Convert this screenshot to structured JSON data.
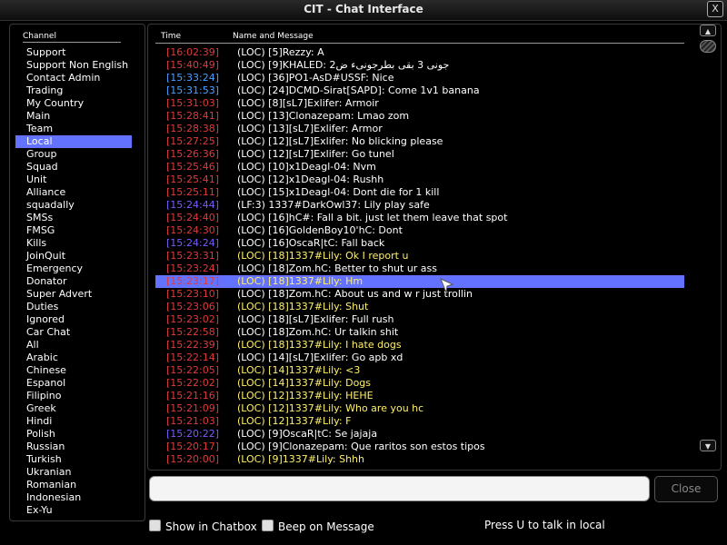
{
  "window": {
    "title": "CIT - Chat Interface",
    "close_glyph": "X"
  },
  "channels": {
    "header": "Channel",
    "selected_index": 7,
    "items": [
      "Support",
      "Support Non English",
      "Contact Admin",
      "Trading",
      "My Country",
      "Main",
      "Team",
      "Local",
      "Group",
      "Squad",
      "Unit",
      "Alliance",
      "squadally",
      "SMSs",
      "FMSG",
      "Kills",
      "JoinQuit",
      "Emergency",
      "Donator",
      "Super Advert",
      "Duties",
      "Ignored",
      "Car Chat",
      "All",
      "Arabic",
      "Chinese",
      "Espanol",
      "Filipino",
      "Greek",
      "Hindi",
      "Polish",
      "Russian",
      "Turkish",
      "Ukranian",
      "Romanian",
      "Indonesian",
      "Ex-Yu"
    ]
  },
  "messages": {
    "col_time": "Time",
    "col_name": "Name and Message",
    "selected_index": 18,
    "items": [
      {
        "time": "[16:02:39]",
        "text": "(LOC) [5]Rezzy: A",
        "time_color": "#e03a3a",
        "text_color": "#ffffff"
      },
      {
        "time": "[15:40:49]",
        "text": "(LOC) [9]KHALED: جونى 3 بقى بطرجونىء ض2",
        "time_color": "#e03a3a",
        "text_color": "#ffffff"
      },
      {
        "time": "[15:33:24]",
        "text": "(LOC) [36]PO1-AsD#USSF: Nice",
        "time_color": "#4aa0ff",
        "text_color": "#ffffff"
      },
      {
        "time": "[15:31:53]",
        "text": "(LOC) [24]DCMD-Sirat[SAPD]: Come 1v1 banana",
        "time_color": "#4aa0ff",
        "text_color": "#ffffff"
      },
      {
        "time": "[15:31:03]",
        "text": "(LOC) [8][sL7]Exlifer: Armoir",
        "time_color": "#e03a3a",
        "text_color": "#ffffff"
      },
      {
        "time": "[15:28:41]",
        "text": "(LOC) [13]Clonazepam: Lmao zom",
        "time_color": "#e03a3a",
        "text_color": "#ffffff"
      },
      {
        "time": "[15:28:38]",
        "text": "(LOC) [13][sL7]Exlifer: Armor",
        "time_color": "#e03a3a",
        "text_color": "#ffffff"
      },
      {
        "time": "[15:27:25]",
        "text": "(LOC) [12][sL7]Exlifer: No blicking please",
        "time_color": "#e03a3a",
        "text_color": "#ffffff"
      },
      {
        "time": "[15:26:36]",
        "text": "(LOC) [12][sL7]Exlifer: Go tunel",
        "time_color": "#e03a3a",
        "text_color": "#ffffff"
      },
      {
        "time": "[15:25:46]",
        "text": "(LOC) [10]x1Deagl-04: Nvm",
        "time_color": "#e03a3a",
        "text_color": "#ffffff"
      },
      {
        "time": "[15:25:41]",
        "text": "(LOC) [12]x1Deagl-04: Rushh",
        "time_color": "#e03a3a",
        "text_color": "#ffffff"
      },
      {
        "time": "[15:25:11]",
        "text": "(LOC) [15]x1Deagl-04: Dont die for 1 kill",
        "time_color": "#e03a3a",
        "text_color": "#ffffff"
      },
      {
        "time": "[15:24:44]",
        "text": "(LF:3) 1337#DarkOwl37: Lily play safe",
        "time_color": "#7a5aff",
        "text_color": "#ffffff"
      },
      {
        "time": "[15:24:40]",
        "text": "(LOC) [16]hC#: Fall a bit. just let them leave that spot",
        "time_color": "#e03a3a",
        "text_color": "#ffffff"
      },
      {
        "time": "[15:24:30]",
        "text": "(LOC) [16]GoldenBoy10'hC: Dont",
        "time_color": "#e03a3a",
        "text_color": "#ffffff"
      },
      {
        "time": "[15:24:24]",
        "text": "(LOC) [16]OscaR|tC: Fall back",
        "time_color": "#7a5aff",
        "text_color": "#ffffff"
      },
      {
        "time": "[15:23:31]",
        "text": "(LOC) [18]1337#Lily: Ok I report u",
        "time_color": "#e03a3a",
        "text_color": "#fff06a"
      },
      {
        "time": "[15:23:24]",
        "text": "(LOC) [18]Zom.hC: Better to shut ur ass",
        "time_color": "#e03a3a",
        "text_color": "#ffffff"
      },
      {
        "time": "[15:23:17]",
        "text": "(LOC) [18]1337#Lily: Hm",
        "time_color": "#e03a3a",
        "text_color": "#fff06a"
      },
      {
        "time": "[15:23:10]",
        "text": "(LOC) [18]Zom.hC: About us and w r just trollin",
        "time_color": "#e03a3a",
        "text_color": "#ffffff"
      },
      {
        "time": "[15:23:06]",
        "text": "(LOC) [18]1337#Lily: Shut",
        "time_color": "#e03a3a",
        "text_color": "#fff06a"
      },
      {
        "time": "[15:23:02]",
        "text": "(LOC) [18][sL7]Exlifer: Full rush",
        "time_color": "#e03a3a",
        "text_color": "#ffffff"
      },
      {
        "time": "[15:22:58]",
        "text": "(LOC) [18]Zom.hC: Ur talkin shit",
        "time_color": "#e03a3a",
        "text_color": "#ffffff"
      },
      {
        "time": "[15:22:39]",
        "text": "(LOC) [18]1337#Lily: I hate dogs",
        "time_color": "#e03a3a",
        "text_color": "#fff06a"
      },
      {
        "time": "[15:22:14]",
        "text": "(LOC) [14][sL7]Exlifer: Go apb xd",
        "time_color": "#e03a3a",
        "text_color": "#ffffff"
      },
      {
        "time": "[15:22:05]",
        "text": "(LOC) [14]1337#Lily: <3",
        "time_color": "#e03a3a",
        "text_color": "#fff06a"
      },
      {
        "time": "[15:22:02]",
        "text": "(LOC) [14]1337#Lily: Dogs",
        "time_color": "#e03a3a",
        "text_color": "#fff06a"
      },
      {
        "time": "[15:21:16]",
        "text": "(LOC) [12]1337#Lily: HEHE",
        "time_color": "#e03a3a",
        "text_color": "#fff06a"
      },
      {
        "time": "[15:21:09]",
        "text": "(LOC) [12]1337#Lily: Who are you hc",
        "time_color": "#e03a3a",
        "text_color": "#fff06a"
      },
      {
        "time": "[15:21:03]",
        "text": "(LOC) [12]1337#Lily: F",
        "time_color": "#e03a3a",
        "text_color": "#fff06a"
      },
      {
        "time": "[15:20:22]",
        "text": "(LOC) [9]OscaR|tC: Se jajaja",
        "time_color": "#7a5aff",
        "text_color": "#ffffff"
      },
      {
        "time": "[15:20:17]",
        "text": "(LOC) [9]Clonazepam: Que raritos son estos tipos",
        "time_color": "#e03a3a",
        "text_color": "#ffffff"
      },
      {
        "time": "[15:20:00]",
        "text": "(LOC) [9]1337#Lily: Shhh",
        "time_color": "#e03a3a",
        "text_color": "#fff06a"
      }
    ]
  },
  "scrollbar": {
    "up_glyph": "▲",
    "down_glyph": "▼"
  },
  "input": {
    "value": "",
    "placeholder": ""
  },
  "close_button": {
    "label": "Close"
  },
  "options": {
    "show_in_chatbox": "Show in Chatbox",
    "beep_on_message": "Beep on Message"
  },
  "hint": "Press U to talk in local",
  "colors": {
    "selection": "#6473ff",
    "own_message": "#fff06a"
  }
}
